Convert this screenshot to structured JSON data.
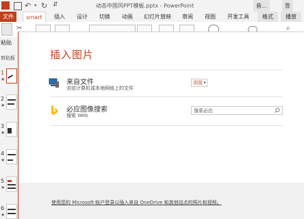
{
  "app": {
    "document_title": "动态中国风PPT模板.pptx - PowerPoint",
    "title_tabs": [
      "音...",
      "签"
    ]
  },
  "ribbon_tabs": [
    "文件",
    "smart",
    "插入",
    "设计",
    "切换",
    "动画",
    "幻灯片放映",
    "审阅",
    "视图",
    "开发工具",
    "格式",
    "播放"
  ],
  "ribbon": {
    "paste_label": "粘贴",
    "clipboard_label": "剪贴板"
  },
  "slides": [
    {
      "num": "1",
      "star": "★"
    },
    {
      "num": "2",
      "star": "★"
    },
    {
      "num": "3",
      "star": "★"
    },
    {
      "num": "4",
      "star": "★"
    },
    {
      "num": "5",
      "star": "★"
    },
    {
      "num": "6",
      "star": "★"
    }
  ],
  "dialog": {
    "title": "插入图片",
    "sources": [
      {
        "title": "来自文件",
        "desc": "浏览计算机或本地网络上的文件",
        "action": "浏览"
      },
      {
        "title": "必应图像搜索",
        "desc": "搜索 Web",
        "placeholder": "搜索必应"
      }
    ],
    "footer": "使用您的 Microsoft 帐户登录以插入来自 OneDrive 和其他站点的照片和视频。"
  },
  "colors": {
    "accent": "#c43e1c",
    "ribbon_bg": "#f3f3f3",
    "footer_bg": "#f0f0f0",
    "bing": "#ffb900"
  }
}
